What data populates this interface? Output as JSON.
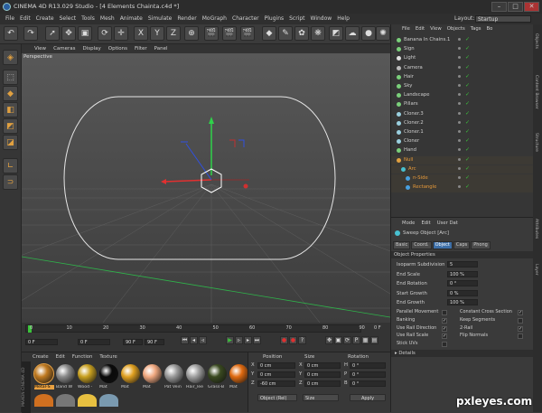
{
  "window": {
    "title": "CINEMA 4D R13.029 Studio - [4 Elements Chainta.c4d *]",
    "minimize": "–",
    "maximize": "□",
    "close": "✕"
  },
  "menu": [
    "File",
    "Edit",
    "Create",
    "Select",
    "Tools",
    "Mesh",
    "Animate",
    "Simulate",
    "Render",
    "MoGraph",
    "Character",
    "Plugins",
    "Script",
    "Window",
    "Help"
  ],
  "layout": {
    "label": "Layout:",
    "value": "Startup"
  },
  "toolbar_icons": [
    {
      "name": "undo-icon",
      "glyph": "↶"
    },
    {
      "name": "redo-icon",
      "glyph": "↷"
    },
    {
      "name": "select-arrow-icon",
      "glyph": "➚"
    },
    {
      "name": "move-icon",
      "glyph": "✥"
    },
    {
      "name": "scale-icon",
      "glyph": "▣"
    },
    {
      "name": "rotate-icon",
      "glyph": "⟳"
    },
    {
      "name": "last-tool-icon",
      "glyph": "✛"
    },
    {
      "name": "x-axis-icon",
      "glyph": "X"
    },
    {
      "name": "y-axis-icon",
      "glyph": "Y"
    },
    {
      "name": "z-axis-icon",
      "glyph": "Z"
    },
    {
      "name": "coordinate-system-icon",
      "glyph": "⊕"
    },
    {
      "name": "render-view-icon",
      "glyph": "🎬"
    },
    {
      "name": "render-picture-viewer-icon",
      "glyph": "🎬"
    },
    {
      "name": "render-settings-icon",
      "glyph": "🎬"
    },
    {
      "name": "cube-icon",
      "glyph": "◆"
    },
    {
      "name": "spline-pen-icon",
      "glyph": "✎"
    },
    {
      "name": "nurbs-icon",
      "glyph": "✿"
    },
    {
      "name": "array-icon",
      "glyph": "❋"
    },
    {
      "name": "deformer-icon",
      "glyph": "◩"
    },
    {
      "name": "environment-icon",
      "glyph": "☁"
    },
    {
      "name": "camera-icon",
      "glyph": "●"
    },
    {
      "name": "light-icon",
      "glyph": "✺"
    }
  ],
  "viewport": {
    "menu": [
      "View",
      "Cameras",
      "Display",
      "Options",
      "Filter",
      "Panel"
    ],
    "label": "Perspective"
  },
  "timeline": {
    "ticks": [
      "0",
      "10",
      "20",
      "30",
      "40",
      "50",
      "60",
      "70",
      "80",
      "90"
    ],
    "end_label": "0 F",
    "start_frame": "0 F",
    "current_frame": "0 F",
    "end_frame": "90 F",
    "end_frame2": "90 F"
  },
  "materials": {
    "menu": [
      "Create",
      "Edit",
      "Function",
      "Texture"
    ],
    "items": [
      {
        "label": "Metal-S",
        "color": "#c07a20"
      },
      {
        "label": "Band W",
        "color": "#8a8a8a"
      },
      {
        "label": "Wood -",
        "color": "#c8a020"
      },
      {
        "label": "Mat",
        "color": "#0a0a0a"
      },
      {
        "label": "Mat",
        "color": "#e0a020"
      },
      {
        "label": "Mat",
        "color": "#f0a880"
      },
      {
        "label": "Pat Vein",
        "color": "#9a9a9a"
      },
      {
        "label": "Hair_lee",
        "color": "#a0a0a0"
      },
      {
        "label": "Grass-B",
        "color": "#3a4a20"
      },
      {
        "label": "Mat",
        "color": "#e06a10"
      }
    ],
    "brand": "MAXON CINEMA 4D"
  },
  "coords": {
    "headers": [
      "Position",
      "Size",
      "Rotation"
    ],
    "rows": [
      {
        "axis": "X",
        "pos": "0 cm",
        "size": "0 cm",
        "rot_axis": "H",
        "rot": "0 °"
      },
      {
        "axis": "Y",
        "pos": "0 cm",
        "size": "0 cm",
        "rot_axis": "P",
        "rot": "0 °"
      },
      {
        "axis": "Z",
        "pos": "-60 cm",
        "size": "0 cm",
        "rot_axis": "B",
        "rot": "0 °"
      }
    ],
    "mode": "Object (Rel)",
    "size_mode": "Size",
    "apply": "Apply"
  },
  "objects": {
    "menu": [
      "File",
      "Edit",
      "View",
      "Objects",
      "Tags",
      "Bo"
    ],
    "items": [
      {
        "name": "Banana In Chains.1",
        "color": "#cfcfcf",
        "indent": 0
      },
      {
        "name": "Sign",
        "color": "#cfcfcf",
        "indent": 0
      },
      {
        "name": "Light",
        "color": "#cfcfcf",
        "indent": 0
      },
      {
        "name": "Camera",
        "color": "#cfcfcf",
        "indent": 0
      },
      {
        "name": "Hair",
        "color": "#cfcfcf",
        "indent": 0
      },
      {
        "name": "Sky",
        "color": "#cfcfcf",
        "indent": 0
      },
      {
        "name": "Landscape",
        "color": "#cfcfcf",
        "indent": 0
      },
      {
        "name": "Pillars",
        "color": "#cfcfcf",
        "indent": 0
      },
      {
        "name": "Cloner.3",
        "color": "#cfcfcf",
        "indent": 0
      },
      {
        "name": "Cloner.2",
        "color": "#cfcfcf",
        "indent": 0
      },
      {
        "name": "Cloner.1",
        "color": "#cfcfcf",
        "indent": 0
      },
      {
        "name": "Cloner",
        "color": "#cfcfcf",
        "indent": 0
      },
      {
        "name": "Hand",
        "color": "#cfcfcf",
        "indent": 0
      },
      {
        "name": "Null",
        "color": "#e89a3a",
        "indent": 0
      },
      {
        "name": "Arc",
        "color": "#e89a3a",
        "indent": 1
      },
      {
        "name": "n-Side",
        "color": "#e89a3a",
        "indent": 2
      },
      {
        "name": "Rectangle",
        "color": "#e89a3a",
        "indent": 2
      }
    ]
  },
  "attributes": {
    "menu": [
      "Mode",
      "Edit",
      "User Dat"
    ],
    "object_title": "Sweep Object [Arc]",
    "tabs": [
      "Basic",
      "Coord.",
      "Object",
      "Caps",
      "Phong"
    ],
    "active_tab": "Object",
    "section": "Object Properties",
    "fields": [
      {
        "label": "Isoparm Subdivision",
        "value": "5"
      },
      {
        "label": "End Scale",
        "value": "100 %"
      },
      {
        "label": "End Rotation",
        "value": "0 °"
      },
      {
        "label": "Start Growth",
        "value": "0 %"
      },
      {
        "label": "End Growth",
        "value": "100 %"
      }
    ],
    "checks_left": [
      {
        "label": "Parallel Movement",
        "checked": ""
      },
      {
        "label": "Banking",
        "checked": "✓"
      },
      {
        "label": "Use Rail Direction",
        "checked": "✓"
      },
      {
        "label": "Use Rail Scale",
        "checked": "✓"
      },
      {
        "label": "Stick UVs",
        "checked": ""
      }
    ],
    "checks_right": [
      {
        "label": "Constant Cross Section",
        "checked": "✓"
      },
      {
        "label": "Keep Segments",
        "checked": ""
      },
      {
        "label": "2-Rail",
        "checked": "✓"
      },
      {
        "label": "Flip Normals",
        "checked": ""
      }
    ],
    "details": "▸ Details"
  },
  "side_tabs": [
    "Objects",
    "Content Browser",
    "Structure",
    "Attributes",
    "Layer"
  ],
  "watermark": "pxleyes.com"
}
